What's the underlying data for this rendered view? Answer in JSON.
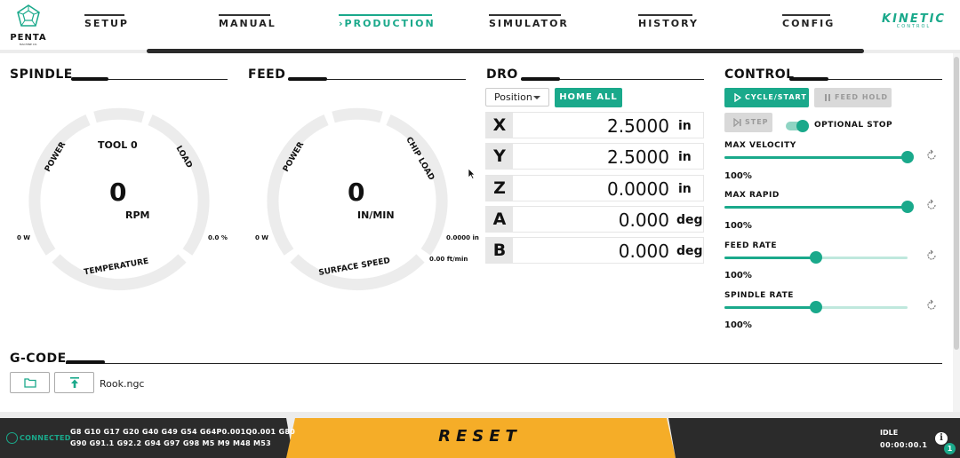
{
  "brand": {
    "logo_word": "PENTA",
    "logo_sub": "MACHINE CO.",
    "name": "KINETIC",
    "sub": "CONTROL"
  },
  "nav": {
    "setup": "SETUP",
    "manual": "MANUAL",
    "production": "›PRODUCTION",
    "simulator": "SIMULATOR",
    "history": "HISTORY",
    "config": "CONFIG"
  },
  "spindle": {
    "title": "SPINDLE",
    "tool": "TOOL 0",
    "value": "0",
    "unit": "RPM",
    "power_label": "POWER",
    "load_label": "LOAD",
    "temp_label": "TEMPERATURE",
    "power_value": "0 W",
    "load_value": "0.0 %"
  },
  "feed": {
    "title": "FEED",
    "value": "0",
    "unit": "IN/MIN",
    "power_label": "POWER",
    "chip_label": "CHIP LOAD",
    "surface_label": "SURFACE SPEED",
    "power_value": "0 W",
    "chip_value": "0.0000 in",
    "surface_value": "0.00 ft/min"
  },
  "dro": {
    "title": "DRO",
    "mode": "Position",
    "home_all": "HOME ALL",
    "axes": [
      {
        "axis": "X",
        "value": "2.5000",
        "unit": "in"
      },
      {
        "axis": "Y",
        "value": "2.5000",
        "unit": "in"
      },
      {
        "axis": "Z",
        "value": "0.0000",
        "unit": "in"
      },
      {
        "axis": "A",
        "value": "0.000",
        "unit": "deg"
      },
      {
        "axis": "B",
        "value": "0.000",
        "unit": "deg"
      }
    ]
  },
  "control": {
    "title": "CONTROL",
    "cycle_start": "CYCLE/START",
    "feed_hold": "FEED HOLD",
    "step": "STEP",
    "optional_stop": "OPTIONAL STOP",
    "optional_stop_on": true,
    "sliders": [
      {
        "label": "MAX VELOCITY",
        "value_text": "100%",
        "level": 1.0
      },
      {
        "label": "MAX RAPID",
        "value_text": "100%",
        "level": 1.0
      },
      {
        "label": "FEED RATE",
        "value_text": "100%",
        "level": 0.5
      },
      {
        "label": "SPINDLE RATE",
        "value_text": "100%",
        "level": 0.5
      }
    ]
  },
  "gcode": {
    "title": "G-CODE",
    "file": "Rook.ngc"
  },
  "status": {
    "connected": "CONNECTED",
    "modal_line1": "G8 G10 G17 G20 G40 G49 G54 G64P0.001Q0.001 G80",
    "modal_line2": "G90 G91.1 G92.2 G94 G97 G98 M5 M9 M48 M53",
    "reset": "RESET",
    "state": "IDLE",
    "time": "00:00:00.1",
    "notifications": "1"
  },
  "colors": {
    "accent": "#1aa98b",
    "reset": "#f5ad28",
    "dark": "#2b2b2b"
  }
}
